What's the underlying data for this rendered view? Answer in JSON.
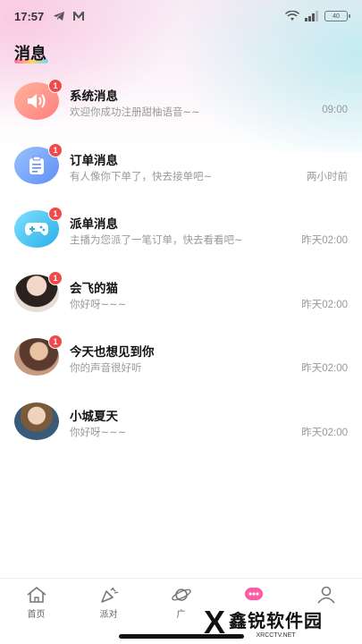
{
  "status_bar": {
    "time": "17:57",
    "battery": "40"
  },
  "page": {
    "title": "消息"
  },
  "messages": [
    {
      "name": "系统消息",
      "preview": "欢迎你成功注册甜柚语音~~",
      "time": "09:00",
      "badge": "1",
      "icon": "speaker-icon"
    },
    {
      "name": "订单消息",
      "preview": "有人像你下单了，快去接单吧~",
      "time": "两小时前",
      "badge": "1",
      "icon": "clipboard-icon"
    },
    {
      "name": "派单消息",
      "preview": "主播为您派了一笔订单，快去看看吧~",
      "time": "昨天02:00",
      "badge": "1",
      "icon": "gamepad-icon"
    },
    {
      "name": "会飞的猫",
      "preview": "你好呀~~~",
      "time": "昨天02:00",
      "badge": "1",
      "icon": "user-avatar"
    },
    {
      "name": "今天也想见到你",
      "preview": "你的声音很好听",
      "time": "昨天02:00",
      "badge": "1",
      "icon": "user-avatar"
    },
    {
      "name": "小城夏天",
      "preview": "你好呀~~~",
      "time": "昨天02:00",
      "badge": "",
      "icon": "user-avatar"
    }
  ],
  "tabs": [
    {
      "label": "首页",
      "icon": "home-icon"
    },
    {
      "label": "派对",
      "icon": "party-icon"
    },
    {
      "label": "广",
      "icon": "planet-icon"
    },
    {
      "label": "",
      "icon": "chat-bubble-icon"
    },
    {
      "label": "",
      "icon": "profile-icon"
    }
  ],
  "watermark": {
    "title": "鑫锐软件园",
    "subtitle": "XRCCTV.NET"
  },
  "colors": {
    "badge": "#f04a4a",
    "tab_active": "#ff5aa5"
  }
}
